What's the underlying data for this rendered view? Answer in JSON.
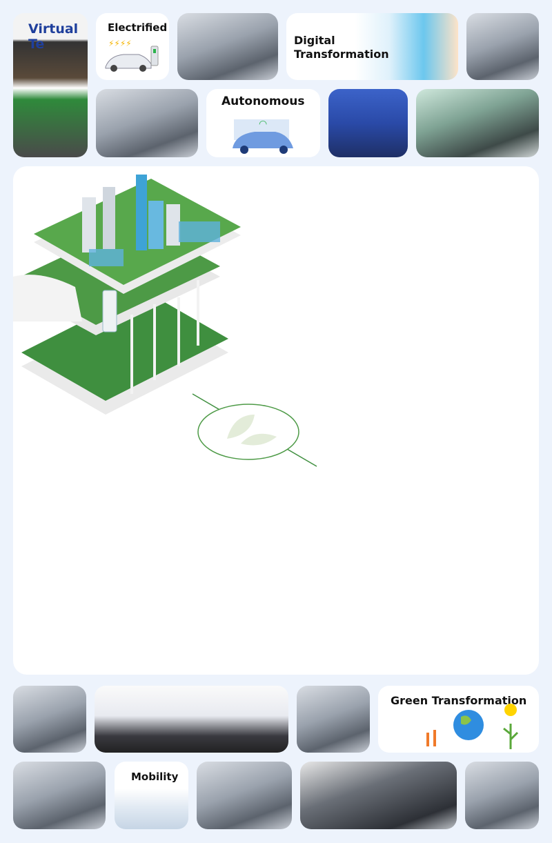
{
  "top_tiles": {
    "virtual_text": "Virtual Te",
    "electrified": "Electrified",
    "digital_transformation": "Digital Transformation",
    "autonomous": "Autonomous"
  },
  "bottom_tiles": {
    "green_transformation": "Green Transformation",
    "mobility": "Mobility"
  },
  "colors": {
    "background": "#edf3fc",
    "green": "#3f8f3f",
    "card": "#ffffff"
  }
}
